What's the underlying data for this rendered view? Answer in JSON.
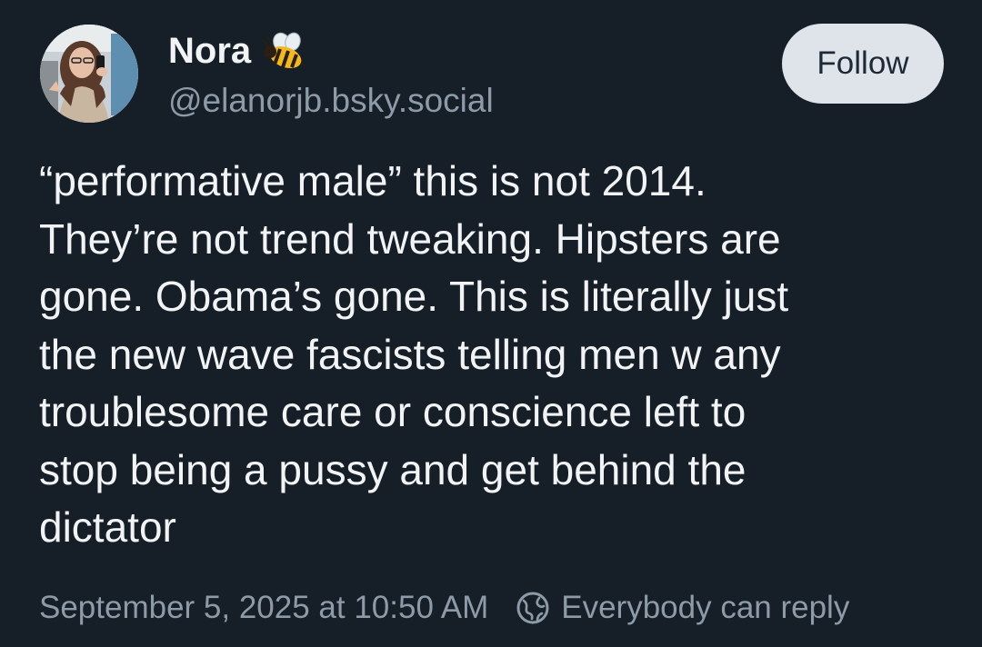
{
  "post": {
    "author": {
      "display_name": "Nora",
      "name_emoji_icon": "bee-icon",
      "handle": "@elanorjb.bsky.social",
      "avatar_icon": "avatar-photo"
    },
    "follow_label": "Follow",
    "text_lines": [
      "“performative male” this is not 2014.",
      "They’re not trend tweaking. Hipsters are",
      "gone. Obama’s gone. This is literally just",
      "the new wave fascists telling men w any",
      "troublesome care or conscience left to",
      "stop being a pussy and get behind the",
      "dictator"
    ],
    "timestamp": "September 5, 2025 at 10:50 AM",
    "reply_setting": {
      "icon": "globe-icon",
      "label": "Everybody can reply"
    }
  },
  "colors": {
    "background": "#161e27",
    "text": "#f1f3f5",
    "muted_text": "#8d9aa8",
    "follow_button_bg": "#dfe4ea",
    "follow_button_text": "#1e2937"
  }
}
